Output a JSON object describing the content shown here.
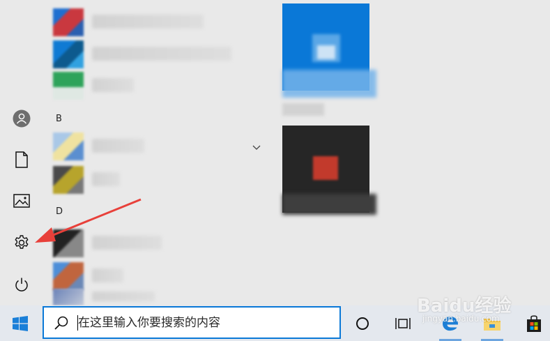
{
  "start_menu": {
    "left_rail": [
      {
        "icon": "user-icon"
      },
      {
        "icon": "document-icon"
      },
      {
        "icon": "pictures-icon"
      },
      {
        "icon": "settings-gear-icon"
      },
      {
        "icon": "power-icon"
      }
    ],
    "group_letters": [
      "B",
      "D"
    ],
    "group_chevron_icon": "chevron-down-icon",
    "tiles": [
      {
        "icon": "blurred-app-tile",
        "color": "#0a78d7"
      },
      {
        "icon": "blurred-app-tile",
        "color": "#262626"
      }
    ],
    "annotation_arrow_color": "#e8403a"
  },
  "taskbar": {
    "search": {
      "placeholder": "在这里输入你要搜索的内容",
      "value": ""
    },
    "buttons": [
      {
        "icon": "windows-start-icon"
      },
      {
        "icon": "cortana-circle-icon"
      },
      {
        "icon": "task-view-icon"
      },
      {
        "icon": "edge-browser-icon"
      },
      {
        "icon": "file-explorer-icon"
      },
      {
        "icon": "store-icon"
      }
    ],
    "accent_color": "#0a78d7"
  },
  "watermark": {
    "main": "Baidu经验",
    "sub": "jingyan.baidu.com"
  }
}
